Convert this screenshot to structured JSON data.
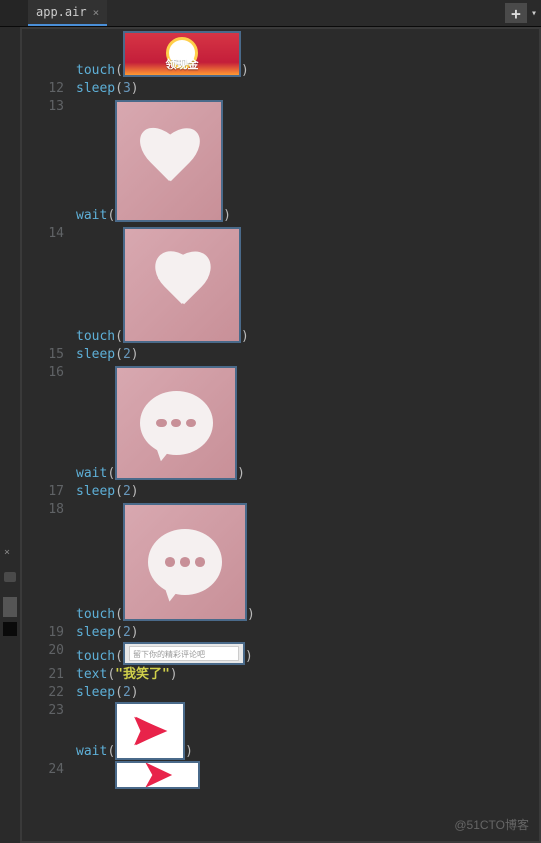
{
  "tab": {
    "name": "app.air",
    "close": "×"
  },
  "toolbar": {
    "plus": "+",
    "arrow": "▾"
  },
  "functions": {
    "touch": "touch",
    "sleep": "sleep",
    "wait": "wait",
    "text": "text"
  },
  "punct": {
    "open": "(",
    "close": ")"
  },
  "lines": {
    "n12": "12",
    "n13": "13",
    "n14": "14",
    "n15": "15",
    "n16": "16",
    "n17": "17",
    "n18": "18",
    "n19": "19",
    "n20": "20",
    "n21": "21",
    "n22": "22",
    "n23": "23",
    "n24": "24"
  },
  "args": {
    "sleep12": "3",
    "sleep15": "2",
    "sleep17": "2",
    "sleep19": "2",
    "sleep22": "2",
    "text21": "\"我笑了\""
  },
  "images": {
    "cash_label": "领现金",
    "input_placeholder": "留下你的精彩评论吧"
  },
  "watermark": "@51CTO博客",
  "panel": {
    "close": "×"
  }
}
